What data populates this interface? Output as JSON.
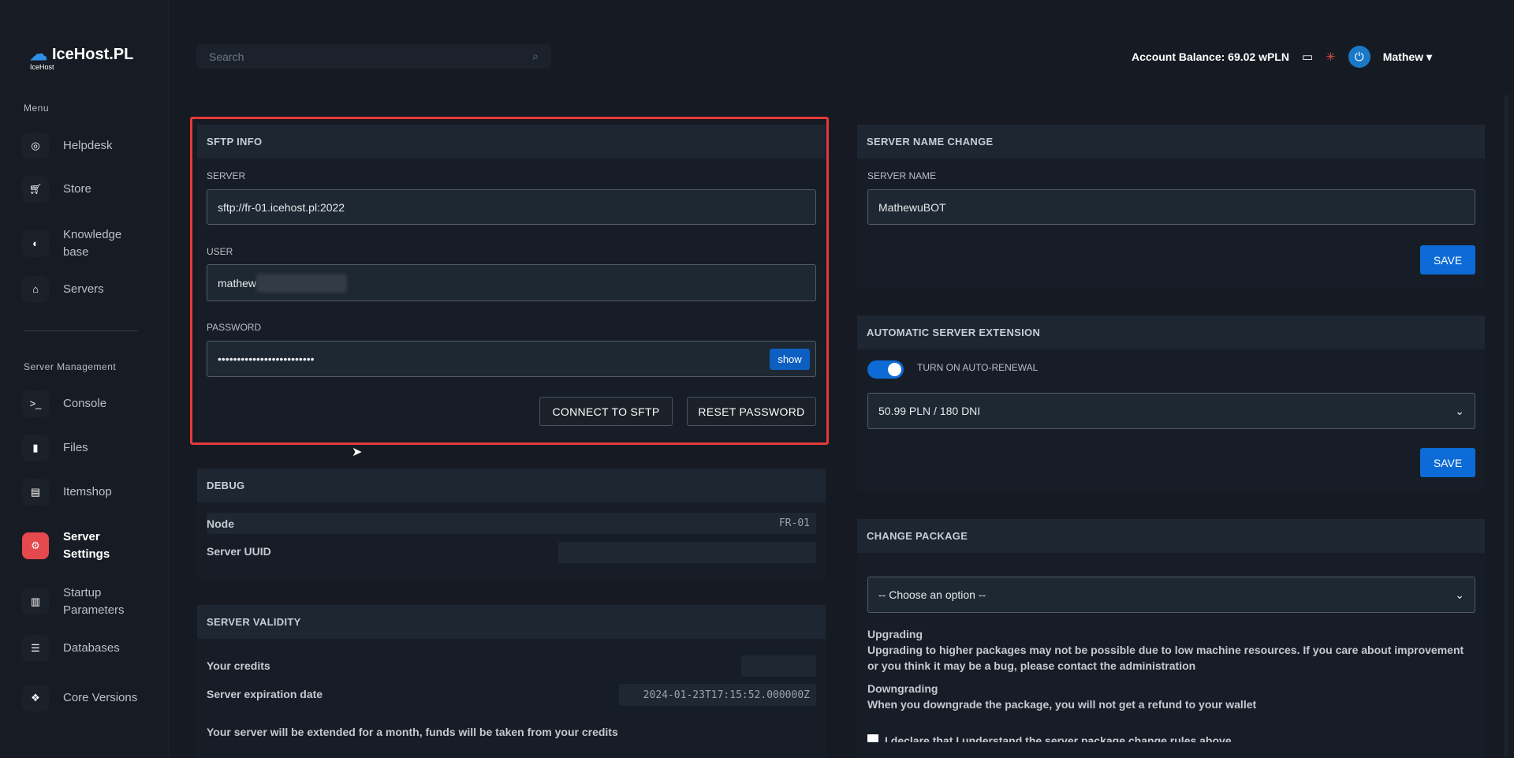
{
  "brand": {
    "name": "IceHost.PL",
    "sub": "IceHost"
  },
  "search": {
    "placeholder": "Search"
  },
  "topbar": {
    "balance": "Account Balance: 69.02 wPLN",
    "user": "Mathew"
  },
  "sidebar": {
    "menu_label": "Menu",
    "items": [
      {
        "label": "Helpdesk"
      },
      {
        "label": "Store"
      },
      {
        "label": "Knowledge base"
      },
      {
        "label": "Servers"
      }
    ],
    "mgmt_label": "Server Management",
    "mgmt_items": [
      {
        "label": "Console"
      },
      {
        "label": "Files"
      },
      {
        "label": "Itemshop"
      },
      {
        "label": "Server Settings"
      },
      {
        "label": "Startup Parameters"
      },
      {
        "label": "Databases"
      },
      {
        "label": "Core Versions"
      }
    ]
  },
  "sftp": {
    "title": "SFTP INFO",
    "server_label": "SERVER",
    "server": "sftp://fr-01.icehost.pl:2022",
    "user_label": "USER",
    "user": "mathew",
    "password_label": "PASSWORD",
    "password": "•••••••••••••••••••••••••",
    "show": "show",
    "connect": "CONNECT TO SFTP",
    "reset": "RESET PASSWORD"
  },
  "debug": {
    "title": "DEBUG",
    "node_label": "Node",
    "node": "FR-01",
    "uuid_label": "Server UUID"
  },
  "validity": {
    "title": "SERVER VALIDITY",
    "credits_label": "Your credits",
    "exp_label": "Server expiration date",
    "exp": "2024-01-23T17:15:52.000000Z",
    "note": "Your server will be extended for a month, funds will be taken from your credits"
  },
  "name_change": {
    "title": "SERVER NAME CHANGE",
    "label": "SERVER NAME",
    "value": "MathewuBOT",
    "save": "SAVE"
  },
  "auto_ext": {
    "title": "AUTOMATIC SERVER EXTENSION",
    "toggle_label": "TURN ON AUTO-RENEWAL",
    "toggle_on": true,
    "option": "50.99 PLN / 180 DNI",
    "save": "SAVE"
  },
  "package": {
    "title": "CHANGE PACKAGE",
    "option": "-- Choose an option --",
    "up_title": "Upgrading",
    "up_text": "Upgrading to higher packages may not be possible due to low machine resources. If you care about improvement or you think it may be a bug, please contact the administration",
    "down_title": "Downgrading",
    "down_text": "When you downgrade the package, you will not get a refund to your wallet",
    "declare": "I declare that I understand the server package change rules above"
  }
}
